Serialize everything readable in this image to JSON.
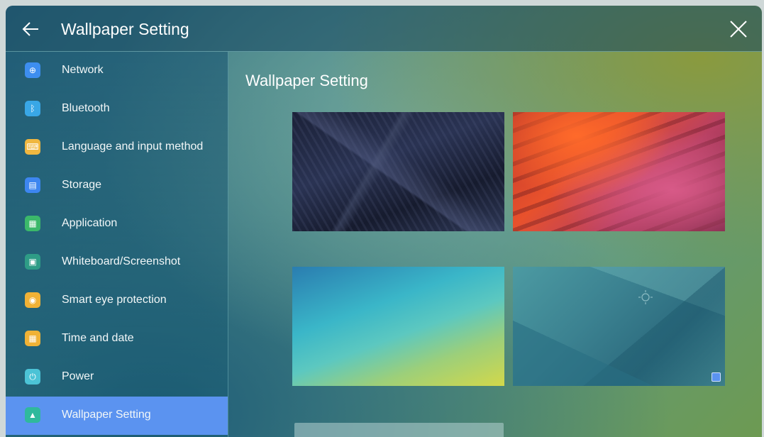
{
  "window": {
    "title": "Wallpaper Setting"
  },
  "sidebar": {
    "items": [
      {
        "label": "Network",
        "icon": "globe-icon",
        "color": "#3d8ef0",
        "glyph": "⊕",
        "active": false
      },
      {
        "label": "Bluetooth",
        "icon": "bluetooth-icon",
        "color": "#39a7e6",
        "glyph": "ᛒ",
        "active": false
      },
      {
        "label": "Language and input method",
        "icon": "keyboard-icon",
        "color": "#f0b740",
        "glyph": "⌨",
        "active": false
      },
      {
        "label": "Storage",
        "icon": "storage-icon",
        "color": "#3d86f0",
        "glyph": "▤",
        "active": false
      },
      {
        "label": "Application",
        "icon": "apps-icon",
        "color": "#3bb86a",
        "glyph": "▦",
        "active": false
      },
      {
        "label": "Whiteboard/Screenshot",
        "icon": "screenshot-icon",
        "color": "#2e9c86",
        "glyph": "▣",
        "active": false
      },
      {
        "label": "Smart eye protection",
        "icon": "eye-icon",
        "color": "#f0b236",
        "glyph": "◉",
        "active": false
      },
      {
        "label": "Time and date",
        "icon": "calendar-icon",
        "color": "#f0b236",
        "glyph": "▦",
        "active": false
      },
      {
        "label": "Power",
        "icon": "power-icon",
        "color": "#4cc3d6",
        "glyph": "⏻",
        "active": false
      },
      {
        "label": "Wallpaper Setting",
        "icon": "wallpaper-icon",
        "color": "#2fb99c",
        "glyph": "▲",
        "active": true
      }
    ]
  },
  "content": {
    "title": "Wallpaper Setting"
  },
  "wallpapers": [
    {
      "name": "dark-architecture",
      "selected": false
    },
    {
      "name": "red-canyon",
      "selected": false
    },
    {
      "name": "blue-green-gradient",
      "selected": false
    },
    {
      "name": "teal-polygon",
      "selected": true
    },
    {
      "name": "partial-next",
      "selected": false
    }
  ]
}
